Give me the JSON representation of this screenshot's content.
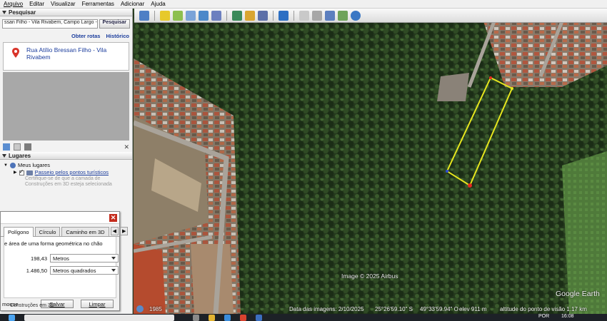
{
  "menu": [
    "Arquivo",
    "Editar",
    "Visualizar",
    "Ferramentas",
    "Adicionar",
    "Ajuda"
  ],
  "search_panel": {
    "header": "Pesquisar",
    "input_value": "ssan Filho - Vila Rivabem, Campo Largo - PR",
    "button": "Pesquisar",
    "links": [
      "Obter rotas",
      "Histórico"
    ],
    "result": "Rua Atílio Bressan Filho - Vila Rivabem"
  },
  "places_panel": {
    "header": "Lugares",
    "my_places": "Meus lugares",
    "tour": "Passeio pelos pontos turísticos",
    "hint": "Certifique-se de que a camada de Construções em 3D esteja selecionada"
  },
  "polygon_dialog": {
    "tabs": [
      "Polígono",
      "Círculo",
      "Caminho em 3D"
    ],
    "description": "e área de uma forma geométrica no chão",
    "perimeter_value": "198,43",
    "perimeter_unit": "Metros",
    "area_value": "1.486,50",
    "area_unit": "Metros quadrados",
    "mouse_label": "mouse",
    "save": "Salvar",
    "clear": "Limpar"
  },
  "sidebar_bottom": "Construções em 3D",
  "map": {
    "caption": "Image © 2025 Airbus",
    "brand": "Google Earth",
    "year": "1985",
    "date_label": "Data das imagens: 2/10/2025",
    "lat": "25°26'59.10\" S",
    "lon": "49°33'59.94\" O",
    "elev": "elev   911 m",
    "alt": "altitude do ponto de visão   1.17 km"
  },
  "taskbar": {
    "lang": "POR",
    "time": "16:08"
  },
  "colors": {
    "polygon_edge": "#e6e61e",
    "polygon_marker": "#e52a1f",
    "link_blue": "#1a3c9c"
  }
}
